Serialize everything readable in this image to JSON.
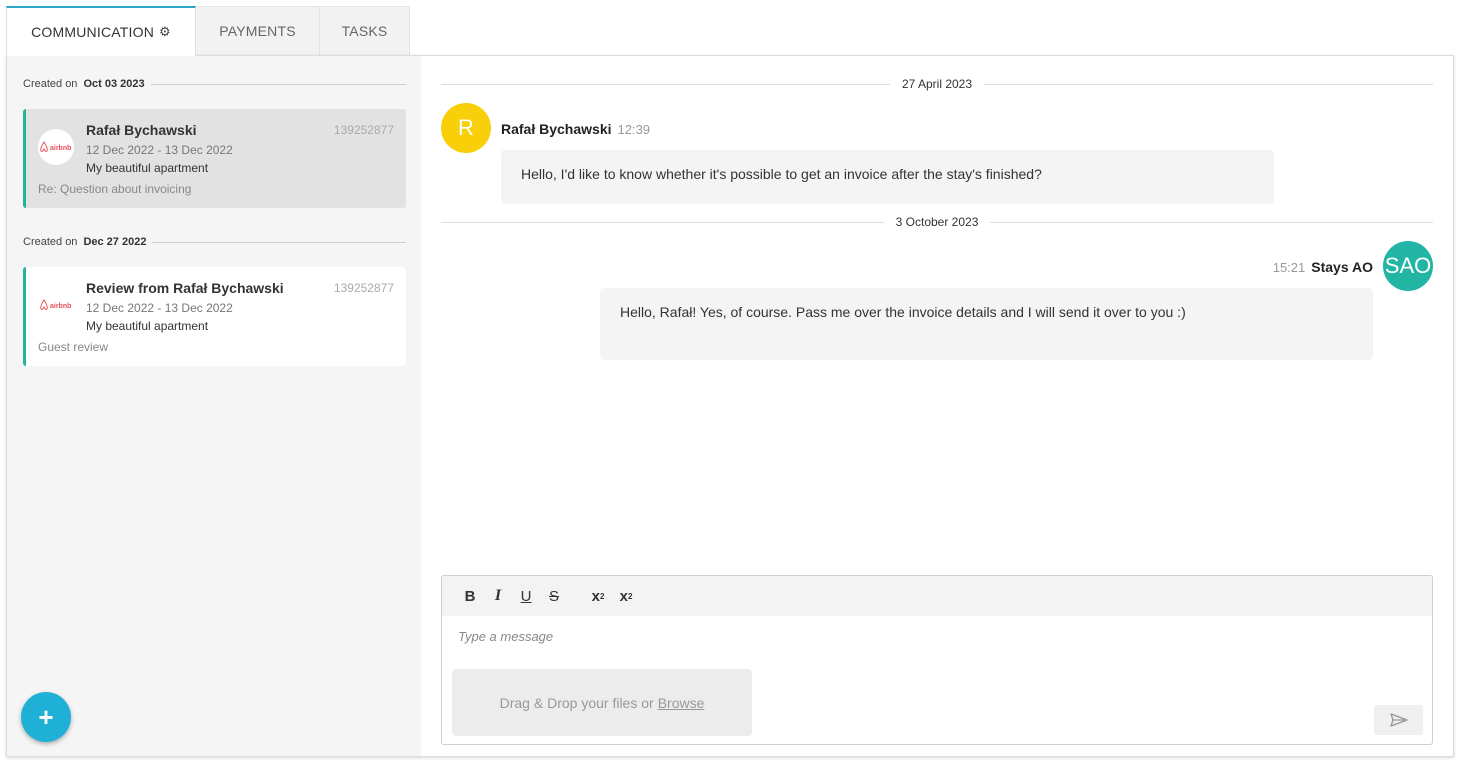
{
  "tabs": [
    {
      "label": "COMMUNICATION",
      "active": true
    },
    {
      "label": "PAYMENTS",
      "active": false
    },
    {
      "label": "TASKS",
      "active": false
    }
  ],
  "threads": [
    {
      "created_label": "Created on",
      "created_date": "Oct 03 2023",
      "name": "Rafał Bychawski",
      "booking_id": "139252877",
      "dates": "12 Dec 2022 - 13 Dec 2022",
      "property": "My beautiful apartment",
      "subject": "Re: Question about invoicing",
      "channel": "airbnb"
    },
    {
      "created_label": "Created on",
      "created_date": "Dec 27 2022",
      "name": "Review from Rafał Bychawski",
      "booking_id": "139252877",
      "dates": "12 Dec 2022 - 13 Dec 2022",
      "property": "My beautiful apartment",
      "subject": "Guest review",
      "channel": "airbnb"
    }
  ],
  "conversation": {
    "days": [
      "27 April 2023",
      "3 October 2023"
    ],
    "messages": [
      {
        "avatar": "R",
        "sender": "Rafał Bychawski",
        "time": "12:39",
        "text": "Hello, I'd like to know whether it's possible to get an invoice after the stay's finished?",
        "color": "#f9cf0a"
      },
      {
        "avatar": "SAO",
        "sender": "Stays AO",
        "time": "15:21",
        "text": "Hello, Rafał! Yes, of course. Pass me over the invoice details and I will send it over to you :)",
        "color": "#22b5a4"
      }
    ]
  },
  "composer": {
    "placeholder": "Type a message",
    "drop_text": "Drag & Drop your files or",
    "browse_label": "Browse",
    "toolbar": {
      "bold": "B",
      "italic": "I",
      "underline": "U",
      "strike": "S",
      "subscript": "x",
      "sub_mark": "2",
      "superscript": "x",
      "sup_mark": "2"
    }
  },
  "fab": {
    "label": "+"
  },
  "icons": {
    "tab_gear": "gear-icon",
    "send": "send-icon",
    "channel_logo": "airbnb-logo-icon"
  }
}
